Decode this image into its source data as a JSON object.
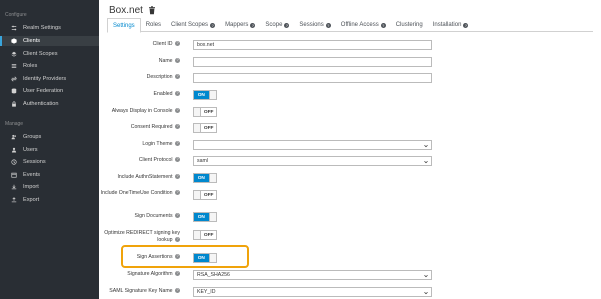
{
  "sidebar": {
    "section_configure": "Configure",
    "section_manage": "Manage",
    "configure_items": [
      {
        "label": "Realm Settings",
        "icon": "sliders-icon"
      },
      {
        "label": "Clients",
        "icon": "cube-icon",
        "active": true
      },
      {
        "label": "Client Scopes",
        "icon": "layers-icon"
      },
      {
        "label": "Roles",
        "icon": "list-icon"
      },
      {
        "label": "Identity Providers",
        "icon": "exchange-icon"
      },
      {
        "label": "User Federation",
        "icon": "database-icon"
      },
      {
        "label": "Authentication",
        "icon": "lock-icon"
      }
    ],
    "manage_items": [
      {
        "label": "Groups",
        "icon": "users-icon"
      },
      {
        "label": "Users",
        "icon": "user-icon"
      },
      {
        "label": "Sessions",
        "icon": "clock-icon"
      },
      {
        "label": "Events",
        "icon": "calendar-icon"
      },
      {
        "label": "Import",
        "icon": "import-icon"
      },
      {
        "label": "Export",
        "icon": "export-icon"
      }
    ]
  },
  "header": {
    "title": "Box.net",
    "delete_icon": "trash-icon"
  },
  "tabs": [
    {
      "label": "Settings",
      "active": true,
      "help": false
    },
    {
      "label": "Roles",
      "help": false
    },
    {
      "label": "Client Scopes",
      "help": true
    },
    {
      "label": "Mappers",
      "help": true
    },
    {
      "label": "Scope",
      "help": true
    },
    {
      "label": "Sessions",
      "help": true
    },
    {
      "label": "Offline Access",
      "help": true
    },
    {
      "label": "Clustering",
      "help": false
    },
    {
      "label": "Installation",
      "help": true
    }
  ],
  "form": {
    "client_id": {
      "label": "Client ID",
      "value": "box.net"
    },
    "name": {
      "label": "Name",
      "value": ""
    },
    "description": {
      "label": "Description",
      "value": ""
    },
    "enabled": {
      "label": "Enabled",
      "state": "ON"
    },
    "always_display": {
      "label": "Always Display in Console",
      "state": "OFF"
    },
    "consent_required": {
      "label": "Consent Required",
      "state": "OFF"
    },
    "login_theme": {
      "label": "Login Theme",
      "value": ""
    },
    "client_protocol": {
      "label": "Client Protocol",
      "value": "saml"
    },
    "include_authn": {
      "label": "Include AuthnStatement",
      "state": "ON"
    },
    "include_onetimeuse": {
      "label": "Include OneTimeUse Condition",
      "state": "OFF"
    },
    "sign_documents": {
      "label": "Sign Documents",
      "state": "ON"
    },
    "optimize_redirect": {
      "label": "Optimize REDIRECT signing key lookup",
      "state": "OFF"
    },
    "sign_assertions": {
      "label": "Sign Assertions",
      "state": "ON"
    },
    "signature_algorithm": {
      "label": "Signature Algorithm",
      "value": "RSA_SHA256"
    },
    "saml_sig_key_name": {
      "label": "SAML Signature Key Name",
      "value": "KEY_ID"
    }
  },
  "colors": {
    "sidebar_bg": "#292e34",
    "accent": "#0088ce",
    "highlight": "#f0a30a"
  }
}
